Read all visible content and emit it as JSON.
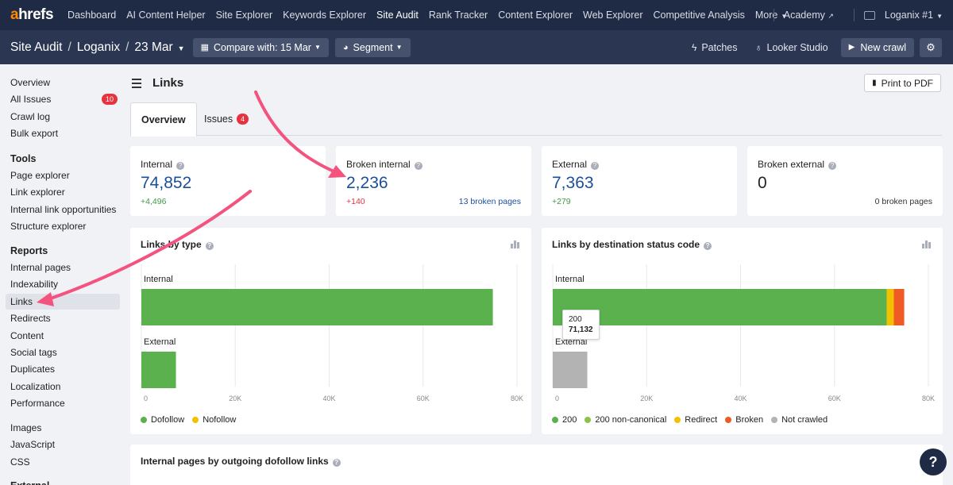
{
  "topnav": {
    "logo_a": "a",
    "logo_rest": "hrefs",
    "items": [
      {
        "label": "Dashboard"
      },
      {
        "label": "AI Content Helper"
      },
      {
        "label": "Site Explorer"
      },
      {
        "label": "Keywords Explorer"
      },
      {
        "label": "Site Audit",
        "active": true
      },
      {
        "label": "Rank Tracker"
      },
      {
        "label": "Content Explorer"
      },
      {
        "label": "Web Explorer"
      },
      {
        "label": "Competitive Analysis"
      },
      {
        "label": "More"
      }
    ],
    "academy": "Academy",
    "account": "Loganix #1"
  },
  "subhead": {
    "crumbs": [
      "Site Audit",
      "Loganix",
      "23 Mar"
    ],
    "compare": "Compare with: 15 Mar",
    "segment": "Segment",
    "patches": "Patches",
    "looker": "Looker Studio",
    "new_crawl": "New crawl"
  },
  "sidebar": {
    "top": [
      {
        "label": "Overview"
      },
      {
        "label": "All Issues",
        "badge": "10"
      },
      {
        "label": "Crawl log"
      },
      {
        "label": "Bulk export"
      }
    ],
    "tools_heading": "Tools",
    "tools": [
      {
        "label": "Page explorer"
      },
      {
        "label": "Link explorer"
      },
      {
        "label": "Internal link opportunities"
      },
      {
        "label": "Structure explorer"
      }
    ],
    "reports_heading": "Reports",
    "reports": [
      {
        "label": "Internal pages"
      },
      {
        "label": "Indexability"
      },
      {
        "label": "Links",
        "active": true
      },
      {
        "label": "Redirects"
      },
      {
        "label": "Content"
      },
      {
        "label": "Social tags"
      },
      {
        "label": "Duplicates"
      },
      {
        "label": "Localization"
      },
      {
        "label": "Performance"
      }
    ],
    "resources": [
      {
        "label": "Images"
      },
      {
        "label": "JavaScript"
      },
      {
        "label": "CSS"
      }
    ],
    "cut_heading": "External"
  },
  "main": {
    "title": "Links",
    "print": "Print to PDF",
    "tabs": [
      {
        "label": "Overview",
        "active": true
      },
      {
        "label": "Issues",
        "badge": "4"
      }
    ],
    "stats": [
      {
        "label": "Internal",
        "value": "74,852",
        "delta": "+4,496",
        "delta_type": "up",
        "extra": ""
      },
      {
        "label": "Broken internal",
        "value": "2,236",
        "delta": "+140",
        "delta_type": "red",
        "extra": "13 broken pages"
      },
      {
        "label": "External",
        "value": "7,363",
        "delta": "+279",
        "delta_type": "up",
        "extra": ""
      },
      {
        "label": "Broken external",
        "value": "0",
        "delta": "",
        "delta_type": "up",
        "extra": "0 broken pages"
      }
    ],
    "bottom_card_title": "Internal pages by outgoing dofollow links"
  },
  "chart_data": [
    {
      "type": "bar",
      "orientation": "horizontal",
      "stacked": true,
      "title": "Links by type",
      "categories": [
        "Internal",
        "External"
      ],
      "series": [
        {
          "name": "Dofollow",
          "color": "#5bb14e",
          "values": [
            74852,
            7363
          ]
        },
        {
          "name": "Nofollow",
          "color": "#f3c000",
          "values": [
            0,
            0
          ]
        }
      ],
      "xlim": [
        0,
        80000
      ],
      "x_ticks": [
        "0",
        "20K",
        "40K",
        "60K",
        "80K"
      ],
      "grid": true,
      "legend": "bottom-left"
    },
    {
      "type": "bar",
      "orientation": "horizontal",
      "stacked": true,
      "title": "Links by destination status code",
      "categories": [
        "Internal",
        "External"
      ],
      "series": [
        {
          "name": "200",
          "color": "#5bb14e",
          "values": [
            71132,
            0
          ]
        },
        {
          "name": "200 non-canonical",
          "color": "#8bc34a",
          "values": [
            0,
            0
          ]
        },
        {
          "name": "Redirect",
          "color": "#f3c000",
          "values": [
            1500,
            0
          ]
        },
        {
          "name": "Broken",
          "color": "#f05a24",
          "values": [
            2220,
            0
          ]
        },
        {
          "name": "Not crawled",
          "color": "#b3b3b3",
          "values": [
            0,
            7363
          ]
        }
      ],
      "xlim": [
        0,
        80000
      ],
      "x_ticks": [
        "0",
        "20K",
        "40K",
        "60K",
        "80K"
      ],
      "grid": true,
      "legend": "bottom-left",
      "tooltip": {
        "label": "200",
        "value": "71,132"
      }
    }
  ]
}
